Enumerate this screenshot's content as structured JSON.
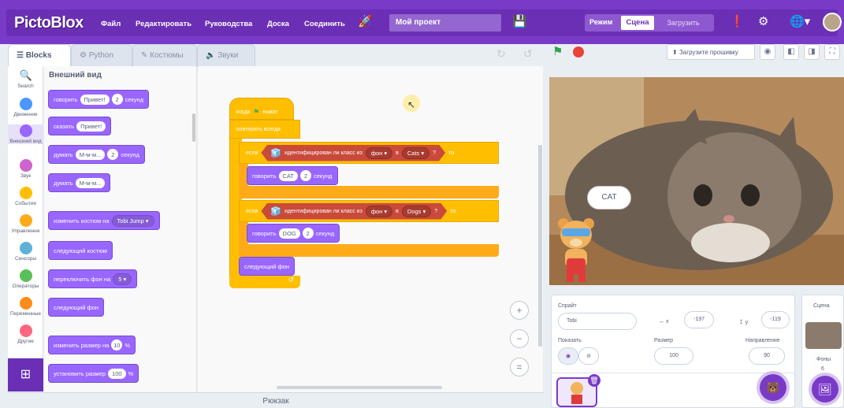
{
  "app": {
    "logo": "PictoBlox"
  },
  "menu": {
    "file": "Файл",
    "edit": "Редактировать",
    "tutorials": "Руководства",
    "board": "Доска",
    "connect": "Соединить",
    "project_name": "Мой проект"
  },
  "mode": {
    "label": "Режим",
    "stage": "Сцена",
    "upload": "Загрузить"
  },
  "tabs": {
    "blocks": "Blocks",
    "python": "Python",
    "costumes": "Костюмы",
    "sounds": "Звуки"
  },
  "categories": [
    {
      "label": "Search",
      "color": "#4c97ff"
    },
    {
      "label": "Движение",
      "color": "#4c97ff"
    },
    {
      "label": "Внешний вид",
      "color": "#9966ff"
    },
    {
      "label": "Звук",
      "color": "#cf63cf"
    },
    {
      "label": "События",
      "color": "#ffbf00"
    },
    {
      "label": "Управление",
      "color": "#ffab19"
    },
    {
      "label": "Сенсоры",
      "color": "#5cb1d6"
    },
    {
      "label": "Операторы",
      "color": "#59c059"
    },
    {
      "label": "Переменные",
      "color": "#ff8c1a"
    },
    {
      "label": "Другие",
      "color": "#ff6680"
    }
  ],
  "palette": {
    "title": "Внешний вид",
    "say_secs": {
      "verb": "говорить",
      "msg": "Привет!",
      "secs": "2",
      "unit": "секунд"
    },
    "say": {
      "verb": "сказать",
      "msg": "Привет!"
    },
    "think_secs": {
      "verb": "думать",
      "msg": "М-м-м...",
      "secs": "2",
      "unit": "секунд"
    },
    "think": {
      "verb": "думать",
      "msg": "М-м-м..."
    },
    "switch_costume": {
      "verb": "изменить костюм на",
      "value": "Tobi Jump"
    },
    "next_costume": "следующий костюм",
    "switch_backdrop": {
      "verb": "переключить фон на",
      "value": "5"
    },
    "next_backdrop": "следующий фон",
    "change_size": {
      "verb": "изменить размер на",
      "value": "10",
      "unit": "%"
    },
    "set_size": {
      "verb": "установить размер",
      "value": "100",
      "unit": "%"
    }
  },
  "script": {
    "hat": {
      "pre": "когда",
      "post": "нажат"
    },
    "forever": "повторять всегда",
    "if1": {
      "if": "если",
      "cond": "идентифицирован ли класс из",
      "src": "фон",
      "in": "в",
      "cls": "Cats",
      "q": "?",
      "then": "то"
    },
    "say1": {
      "verb": "говорить",
      "msg": "CAT",
      "secs": "2",
      "unit": "секунд"
    },
    "if2": {
      "if": "если",
      "cond": "идентифицирован ли класс из",
      "src": "фон",
      "in": "в",
      "cls": "Dogs",
      "q": "?",
      "then": "то"
    },
    "say2": {
      "verb": "говорить",
      "msg": "DOG",
      "secs": "2",
      "unit": "секунд"
    },
    "next_backdrop": "следующий фон"
  },
  "backpack": "Рюкзак",
  "stage_toolbar": {
    "upload_firmware": "Загрузите прошивку"
  },
  "stage": {
    "speech": "CAT"
  },
  "sprite_panel": {
    "sprite_label": "Спрайт",
    "sprite_name": "Tobi",
    "x_label": "x",
    "x": "-197",
    "y_label": "y",
    "y": "-119",
    "show_label": "Показать",
    "size_label": "Размер",
    "size": "100",
    "dir_label": "Направление",
    "dir": "90"
  },
  "stage_panel": {
    "title": "Сцена",
    "backdrops_label": "Фоны",
    "backdrops_count": "6"
  }
}
